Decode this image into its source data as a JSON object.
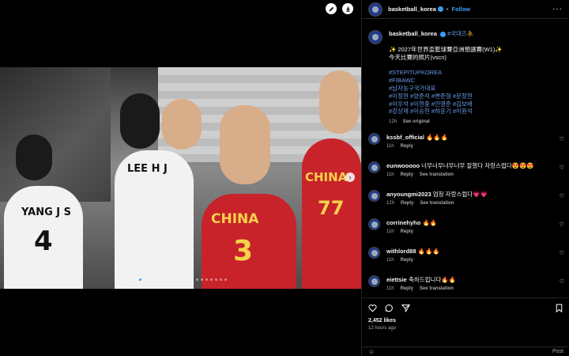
{
  "post": {
    "username": "basketball_korea",
    "follow_label": "Follow",
    "caption_lines": [
      "✨ 2027年世界盃籃球賽亞洲預選賽(W1)✨",
      "今天比賽的照片(vscn)"
    ],
    "caption_tag": "#국대즈⛹",
    "hashtags": [
      "#STEPITUPKOREA",
      "#FIBAWC",
      "#남자농구국가대표",
      "#이정현 #양준석 #변준형 #문정현",
      "#이우석 #이현중 #안영준 #김보배",
      "#강상재 #이승현 #하윤기 #이원석"
    ],
    "caption_time": "12h",
    "see_original": "See original"
  },
  "comments": [
    {
      "user": "kssbf_official",
      "text": "🔥🔥🔥",
      "time": "11h",
      "reply": "Reply",
      "translation": ""
    },
    {
      "user": "eunwooooo",
      "text": "너무너무너무너무 잘했다 자랑스럽다😍😍😍",
      "time": "11h",
      "reply": "Reply",
      "translation": "See translation"
    },
    {
      "user": "anyoungmi2023",
      "text": "엄청 자랑스럽다💗💗",
      "time": "12h",
      "reply": "Reply",
      "translation": "See translation"
    },
    {
      "user": "corrinehyho",
      "text": "🔥🔥",
      "time": "11h",
      "reply": "Reply",
      "translation": ""
    },
    {
      "user": "withlord88",
      "text": "🔥🔥🔥",
      "time": "11h",
      "reply": "Reply",
      "translation": ""
    },
    {
      "user": "eiettsie",
      "text": "축하드립니다🔥🔥",
      "time": "11h",
      "reply": "Reply",
      "translation": "See translation"
    }
  ],
  "likes_label": "2,452 likes",
  "time_ago": "12 hours ago",
  "post_button": "Post",
  "photo": {
    "jersey_left_name": "YANG J S",
    "jersey_left_number": "4",
    "jersey_mid_name": "LEE H J",
    "china_label": "CHINA",
    "china_number_center": "3",
    "china_number_right": "77"
  },
  "carousel": {
    "total": 20,
    "active": 1
  },
  "colors": {
    "accent": "#3d9cf5",
    "hashtag": "#6a9be8",
    "china_red": "#c8232b"
  },
  "icons": [
    "edit-icon",
    "download-icon",
    "heart-icon",
    "comment-icon",
    "share-icon",
    "bookmark-icon",
    "more-icon",
    "next-arrow-icon",
    "emoji-icon"
  ]
}
